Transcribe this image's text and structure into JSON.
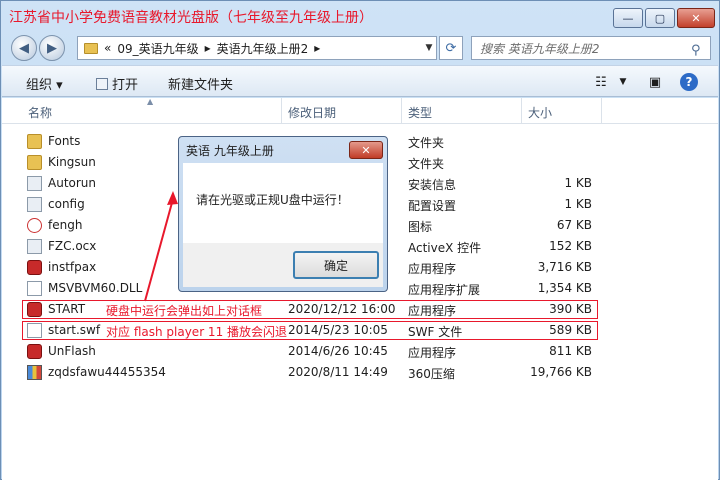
{
  "window": {
    "title": "江苏省中小学免费语音教材光盘版（七年级至九年级上册）",
    "controls": {
      "minimize": "—",
      "maximize": "▢",
      "close": "✕"
    }
  },
  "address": {
    "chevron": "«",
    "crumbs": [
      "09_英语九年级",
      "英语九年级上册2"
    ],
    "separator": "▸"
  },
  "search": {
    "placeholder": "搜索 英语九年级上册2"
  },
  "toolbar": {
    "organize": "组织 ▾",
    "open": "打开",
    "new_folder": "新建文件夹"
  },
  "columns": {
    "name": "名称",
    "date": "修改日期",
    "type": "类型",
    "size": "大小"
  },
  "files": [
    {
      "name": "Fonts",
      "date": "",
      "type": "文件夹",
      "size": "",
      "icon": "folder-icon"
    },
    {
      "name": "Kingsun",
      "date": "",
      "type": "文件夹",
      "size": "",
      "icon": "folder-icon"
    },
    {
      "name": "Autorun",
      "date": "",
      "type": "安装信息",
      "size": "1 KB",
      "icon": "settings-file-icon"
    },
    {
      "name": "config",
      "date": "",
      "type": "配置设置",
      "size": "1 KB",
      "icon": "settings-file-icon"
    },
    {
      "name": "fengh",
      "date": "",
      "type": "图标",
      "size": "67 KB",
      "icon": "bird-icon"
    },
    {
      "name": "FZC.ocx",
      "date": "",
      "type": "ActiveX 控件",
      "size": "152 KB",
      "icon": "settings-file-icon"
    },
    {
      "name": "instfpax",
      "date": "",
      "type": "应用程序",
      "size": "3,716 KB",
      "icon": "app-icon"
    },
    {
      "name": "MSVBVM60.DLL",
      "date": "",
      "type": "应用程序扩展",
      "size": "1,354 KB",
      "icon": "file-icon"
    },
    {
      "name": "START",
      "date": "2020/12/12 16:00",
      "type": "应用程序",
      "size": "390 KB",
      "icon": "app-icon"
    },
    {
      "name": "start.swf",
      "date": "2014/5/23 10:05",
      "type": "SWF 文件",
      "size": "589 KB",
      "icon": "file-icon"
    },
    {
      "name": "UnFlash",
      "date": "2014/6/26 10:45",
      "type": "应用程序",
      "size": "811 KB",
      "icon": "app-icon"
    },
    {
      "name": "zqdsfawu44455354",
      "date": "2020/8/11 14:49",
      "type": "360压缩",
      "size": "19,766 KB",
      "icon": "archive-icon"
    }
  ],
  "annotations": {
    "start_note": "硬盘中运行会弹出如上对话框",
    "swf_note": "对应 flash player 11 播放会闪退"
  },
  "dialog": {
    "title": "英语 九年级上册",
    "message": "请在光驱或正规U盘中运行！",
    "ok": "确定",
    "close": "✕"
  },
  "colors": {
    "accent_red": "#e8182c"
  }
}
